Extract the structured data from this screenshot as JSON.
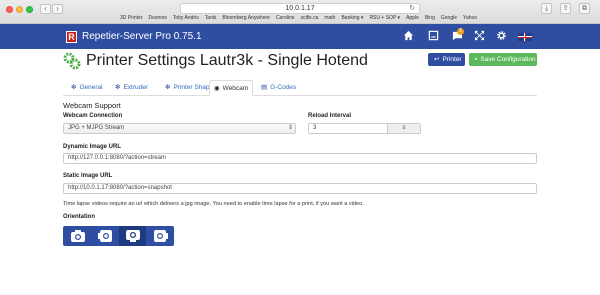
{
  "browser": {
    "url": "10.0.1.17",
    "bookmarks": [
      "3D Printer",
      "Desmos",
      "Toby Andris",
      "Tanki",
      "Bloomberg Anywhere",
      "Caroline",
      "scifis.ca",
      "math",
      "Banking ▾",
      "RSU + SOP ▾",
      "Apple",
      "Bing",
      "Google",
      "Yahoo"
    ]
  },
  "app": {
    "logo_letter": "R",
    "title": "Repetier-Server Pro 0.75.1",
    "message_count": "1",
    "icons": [
      "home-icon",
      "document-icon",
      "message-icon",
      "expand-icon",
      "gear-icon",
      "uk-flag-icon"
    ]
  },
  "page": {
    "title": "Printer Settings Lautr3k - Single Hotend",
    "printer_button": "Printer",
    "save_button": "Save Configuration"
  },
  "tabs": [
    {
      "label": "General",
      "icon": "gears-icon"
    },
    {
      "label": "Extruder",
      "icon": "gears-icon"
    },
    {
      "label": "Printer Shape",
      "icon": "gears-icon"
    },
    {
      "label": "Webcam",
      "icon": "webcam-icon",
      "active": true
    },
    {
      "label": "G-Codes",
      "icon": "document-icon"
    }
  ],
  "webcam": {
    "section_title": "Webcam Support",
    "connection_label": "Webcam Connection",
    "connection_value": "JPG + MJPG Stream",
    "reload_label": "Reload Interval",
    "reload_value": "3",
    "reload_unit": "s",
    "dynamic_label": "Dynamic Image URL",
    "dynamic_value": "http://127.0.0.1:8080/?action=stream",
    "static_label": "Static Image URL",
    "static_value": "http://10.0.1.17:8080/?action=snapshot",
    "help_text": "Time lapse videos require an url which delivers a jpg image. You need to enable time lapse for a print, if you want a video.",
    "orientation_label": "Orientation",
    "orientation_options": [
      "rotate-0",
      "rotate-90",
      "rotate-180",
      "rotate-270"
    ],
    "orientation_selected": "rotate-180"
  },
  "colors": {
    "header": "#2f4ea1",
    "save": "#5cb85c",
    "link": "#2f6dc0"
  }
}
